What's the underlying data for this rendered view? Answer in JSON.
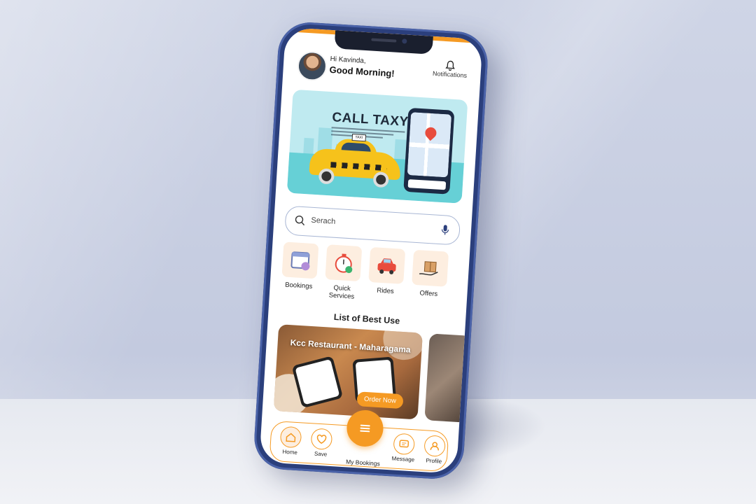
{
  "header": {
    "greeting_small": "Hi Kavinda,",
    "greeting_big": "Good Morning!",
    "notifications_label": "Notifications",
    "notifications_icon": "bell-icon"
  },
  "banner": {
    "title": "CALL TAXY",
    "mini_sign": "TAXI"
  },
  "search": {
    "placeholder": "Serach",
    "search_icon": "search-icon",
    "mic_icon": "mic-icon"
  },
  "categories": [
    {
      "label": "Bookings",
      "icon": "calendar-icon"
    },
    {
      "label": "Quick Services",
      "icon": "stopwatch-icon"
    },
    {
      "label": "Rides",
      "icon": "car-icon"
    },
    {
      "label": "Offers",
      "icon": "gift-box-icon"
    }
  ],
  "section": {
    "title": "List of Best Use"
  },
  "featured_card": {
    "title": "Kcc Restaurant - Maharagama",
    "button": "Order Now"
  },
  "tabbar": {
    "items": [
      {
        "label": "Home",
        "icon": "home-icon"
      },
      {
        "label": "Save",
        "icon": "heart-icon"
      },
      {
        "label": "My Bookings",
        "icon": "menu-icon"
      },
      {
        "label": "Message",
        "icon": "message-icon"
      },
      {
        "label": "Profile",
        "icon": "user-icon"
      }
    ]
  },
  "colors": {
    "accent": "#f59a23",
    "phone_frame": "#2b3f7c",
    "taxi_yellow": "#f6c21b"
  }
}
